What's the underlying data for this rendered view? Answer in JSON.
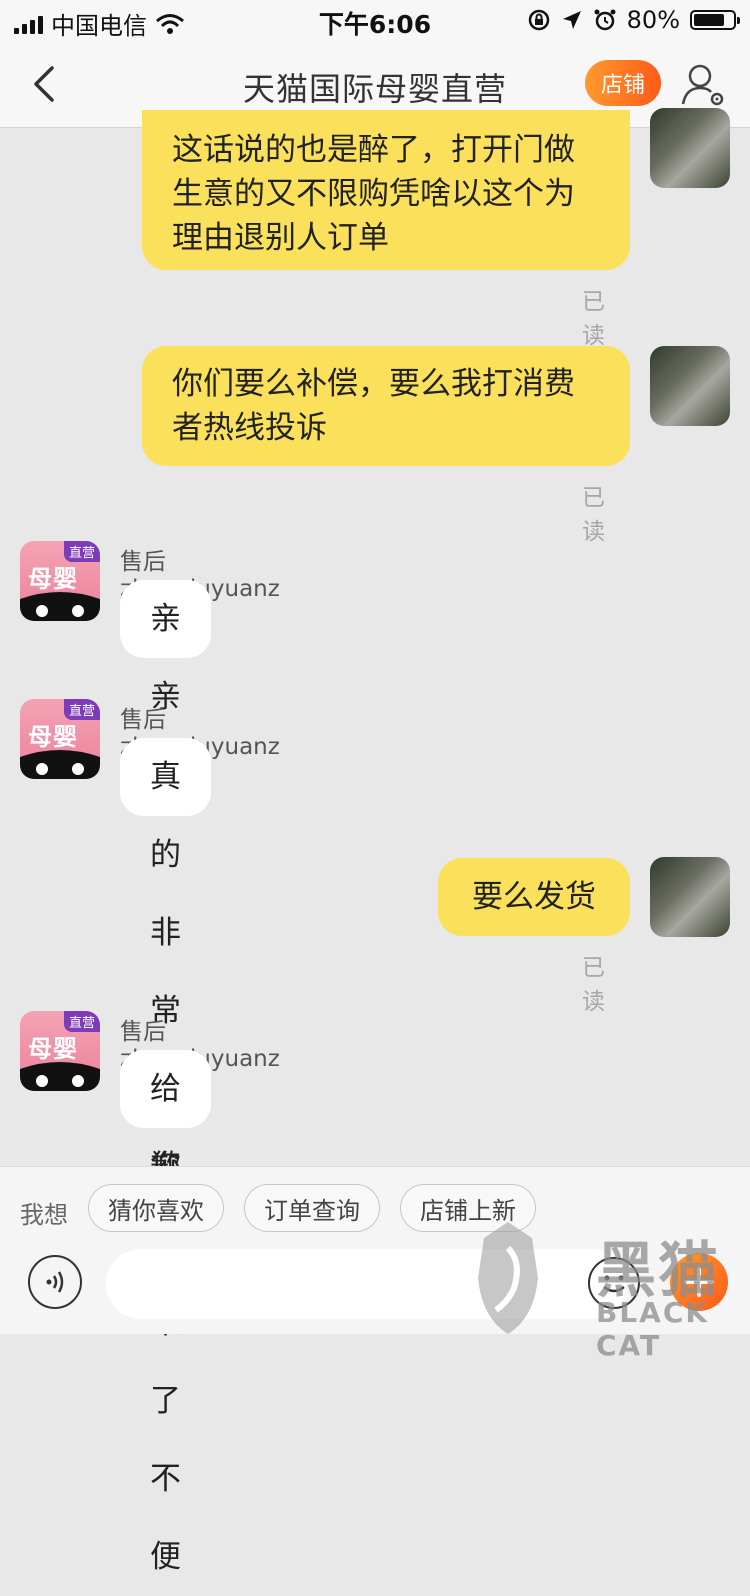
{
  "status": {
    "carrier": "中国电信",
    "time": "下午6:06",
    "battery": "80%",
    "battery_level": 0.8
  },
  "nav": {
    "title": "天猫国际母婴直营",
    "shop_button": "店铺"
  },
  "messages": [
    {
      "side": "me",
      "text_lines": [
        "这话说的也是醉了，打开门做",
        "生意的又不限购凭啥以这个为",
        "理由退别人订单"
      ],
      "read": "已读"
    },
    {
      "side": "me",
      "text_lines": [
        "你们要么补偿，要么我打消费",
        "者热线投诉"
      ],
      "read": "已读"
    },
    {
      "side": "them",
      "sender": "售后zhangluyuanz",
      "text": "亲亲"
    },
    {
      "side": "them",
      "sender": "售后zhangluyuanz",
      "text": "真的非常抱歉"
    },
    {
      "side": "me",
      "text": "要么发货",
      "read": "已读"
    },
    {
      "side": "them",
      "sender": "售后zhangluyuanz",
      "text": "给您带来了不便"
    }
  ],
  "avatar_shop": {
    "label": "母婴",
    "badge": "直营"
  },
  "quick": {
    "label": "我想",
    "chips": [
      "猜你喜欢",
      "订单查询",
      "店铺上新"
    ]
  },
  "input": {
    "value": "",
    "placeholder": ""
  },
  "watermark": {
    "cn": "黑猫",
    "en": "BLACK CAT"
  },
  "colors": {
    "my_bubble": "#fbe15b",
    "their_bubble": "#ffffff",
    "accent": "#ff7a22",
    "background": "#e8e8e8"
  },
  "icons": [
    "back-chevron-icon",
    "profile-settings-icon",
    "voice-icon",
    "emoji-icon",
    "plus-icon",
    "wifi-icon",
    "location-icon",
    "alarm-icon",
    "lock-rotation-icon"
  ]
}
